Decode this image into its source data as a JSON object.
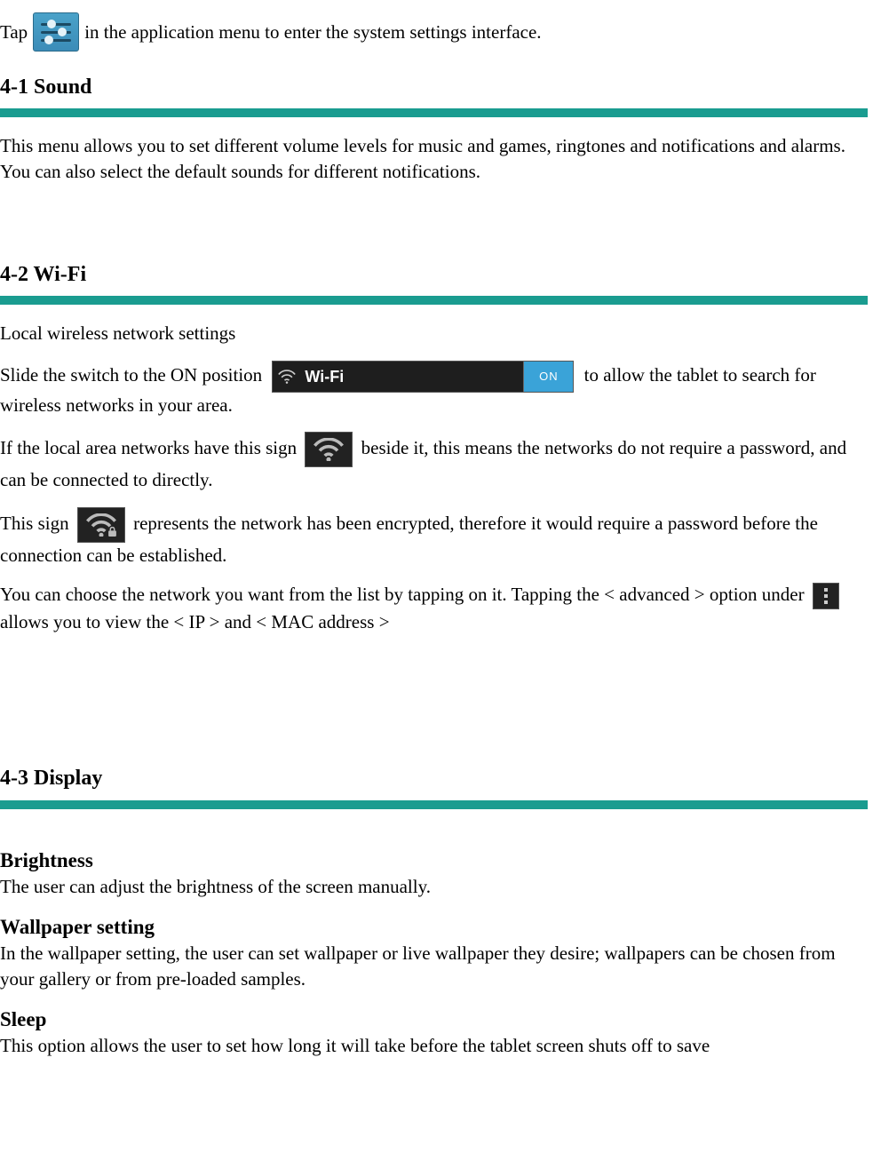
{
  "intro": {
    "pre": "Tap",
    "post": "in the application menu to enter the system settings interface."
  },
  "sections": {
    "sound": {
      "heading": "4-1 Sound",
      "body": "This menu allows you to set different volume levels for music and games, ringtones and notifications and alarms.    You can also select the default sounds for different notifications."
    },
    "wifi": {
      "heading": "4-2 Wi-Fi",
      "line1": "Local wireless network settings",
      "line2_pre": "Slide the switch to the ON position",
      "line2_post": "to allow the tablet to search for wireless networks in your area.",
      "toggle_label": "Wi-Fi",
      "toggle_state": "ON",
      "line3_pre": "If the local area networks have this sign",
      "line3_post": "beside it, this means the networks do not require a password, and can be connected to directly.",
      "line4_pre": "This sign",
      "line4_post": "represents the network has been encrypted, therefore it would require a password before the connection can be established.",
      "line5_pre": "You can choose the network you want from the list by tapping on it. Tapping the < advanced > option under",
      "line5_post": "allows you to view the < IP > and < MAC address >"
    },
    "display": {
      "heading": "4-3 Display",
      "brightness_h": "Brightness",
      "brightness_b": "The user can adjust the brightness of the screen manually.",
      "wallpaper_h": "Wallpaper setting",
      "wallpaper_b": "In the wallpaper setting, the user can set wallpaper or live wallpaper they desire; wallpapers can be chosen from your gallery or from pre-loaded samples.",
      "sleep_h": "Sleep",
      "sleep_b": "This option allows the user to set how long it will take before the tablet screen shuts off to save"
    }
  }
}
